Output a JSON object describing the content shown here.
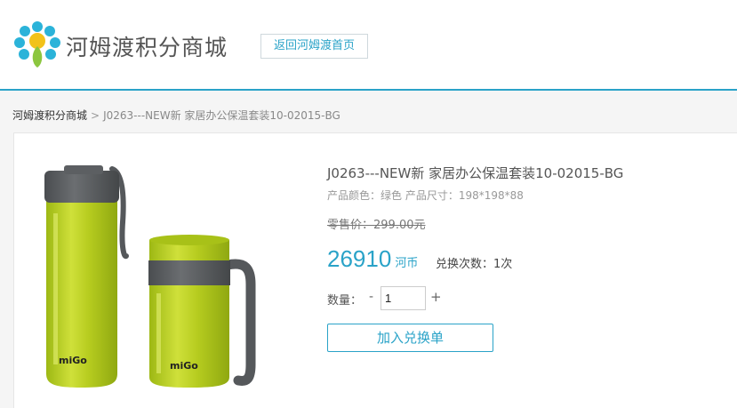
{
  "header": {
    "site_title": "河姆渡积分商城",
    "home_button": "返回河姆渡首页"
  },
  "breadcrumb": {
    "home": "河姆渡积分商城",
    "separator": ">",
    "current": "J0263---NEW新 家居办公保温套装10-02015-BG"
  },
  "product": {
    "title": "J0263---NEW新 家居办公保温套装10-02015-BG",
    "attributes": "产品颜色：绿色 产品尺寸：198*198*88",
    "retail_price": "零售价：299.00元",
    "price_amount": "26910",
    "price_unit": "河币",
    "exchange_limit": "兑换次数：1次",
    "brand_mark": "miGo",
    "quantity_label": "数量：",
    "quantity_minus": "-",
    "quantity_value": "1",
    "quantity_plus": "+",
    "add_button": "加入兑换单"
  },
  "colors": {
    "accent": "#2aa3c8",
    "product_green": "#b6cc1f",
    "product_gray": "#5a5d60"
  }
}
